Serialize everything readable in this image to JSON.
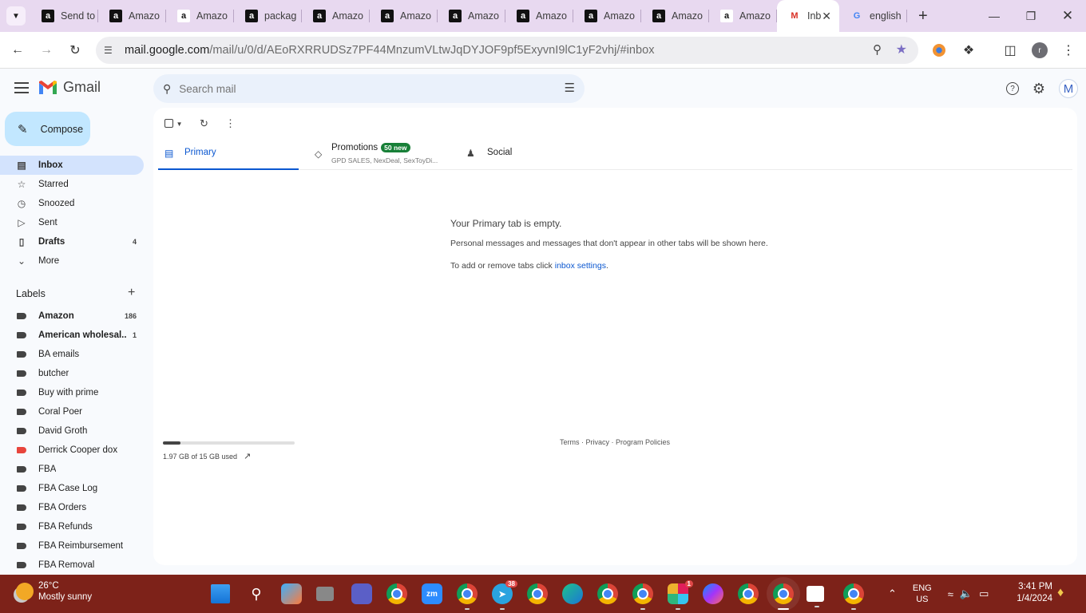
{
  "browser": {
    "tabs": [
      {
        "title": "Send to",
        "favicon": "amazon-a-icon"
      },
      {
        "title": "Amazo",
        "favicon": "amazon-a-icon"
      },
      {
        "title": "Amazo",
        "favicon": "amazon-icon"
      },
      {
        "title": "packag",
        "favicon": "amazon-a-icon"
      },
      {
        "title": "Amazo",
        "favicon": "amazon-a-icon"
      },
      {
        "title": "Amazo",
        "favicon": "amazon-a-icon"
      },
      {
        "title": "Amazo",
        "favicon": "amazon-a-icon"
      },
      {
        "title": "Amazo",
        "favicon": "amazon-a-icon"
      },
      {
        "title": "Amazo",
        "favicon": "amazon-a-icon"
      },
      {
        "title": "Amazo",
        "favicon": "amazon-a-icon"
      },
      {
        "title": "Amazo",
        "favicon": "amazon-icon"
      },
      {
        "title": "Inb",
        "favicon": "gmail-icon",
        "active": true
      },
      {
        "title": "english",
        "favicon": "google-icon"
      }
    ],
    "url_host": "mail.google.com",
    "url_path": "/mail/u/0/d/AEoRXRRUDSz7PF44MnzumVLtwJqDYJOF9pf5ExyvnI9lC1yF2vhj/#inbox"
  },
  "gmail": {
    "app_name": "Gmail",
    "search_placeholder": "Search mail",
    "avatar_letter": "M",
    "compose_label": "Compose",
    "nav": [
      {
        "label": "Inbox",
        "count": "",
        "icon": "inbox-icon",
        "active": true
      },
      {
        "label": "Starred",
        "count": "",
        "icon": "star-icon"
      },
      {
        "label": "Snoozed",
        "count": "",
        "icon": "clock-icon"
      },
      {
        "label": "Sent",
        "count": "",
        "icon": "send-icon"
      },
      {
        "label": "Drafts",
        "count": "4",
        "icon": "draft-icon",
        "bold": true
      },
      {
        "label": "More",
        "count": "",
        "icon": "chevron-down-icon"
      }
    ],
    "labels_heading": "Labels",
    "labels": [
      {
        "label": "Amazon",
        "count": "186",
        "bold": true
      },
      {
        "label": "American wholesal...",
        "count": "1",
        "bold": true
      },
      {
        "label": "BA emails",
        "count": ""
      },
      {
        "label": "butcher",
        "count": ""
      },
      {
        "label": "Buy with prime",
        "count": ""
      },
      {
        "label": "Coral Poer",
        "count": ""
      },
      {
        "label": "David Groth",
        "count": ""
      },
      {
        "label": "Derrick Cooper dox",
        "count": "",
        "color": "#e8453c"
      },
      {
        "label": "FBA",
        "count": ""
      },
      {
        "label": "FBA Case Log",
        "count": ""
      },
      {
        "label": "FBA Orders",
        "count": ""
      },
      {
        "label": "FBA Refunds",
        "count": ""
      },
      {
        "label": "FBA Reimbursement",
        "count": ""
      },
      {
        "label": "FBA Removal",
        "count": ""
      }
    ],
    "inbox_tabs": {
      "primary": "Primary",
      "promotions": "Promotions",
      "promotions_badge": "50 new",
      "promotions_sub": "GPD SALES, NexDeal, SexToyDi...",
      "social": "Social"
    },
    "empty": {
      "title": "Your Primary tab is empty.",
      "body": "Personal messages and messages that don't appear in other tabs will be shown here.",
      "settings_prefix": "To add or remove tabs click ",
      "settings_link": "inbox settings",
      "settings_suffix": "."
    },
    "storage": {
      "text": "1.97 GB of 15 GB used",
      "used_fraction": 0.131
    },
    "footer": {
      "terms": "Terms",
      "sep1": " · ",
      "privacy": "Privacy",
      "sep2": " · ",
      "policies": "Program Policies"
    }
  },
  "taskbar": {
    "weather_temp": "26°C",
    "weather_desc": "Mostly sunny",
    "telegram_badge": "38",
    "slack_badge": "1",
    "lang_top": "ENG",
    "lang_bottom": "US",
    "time": "3:41 PM",
    "date": "1/4/2024"
  }
}
